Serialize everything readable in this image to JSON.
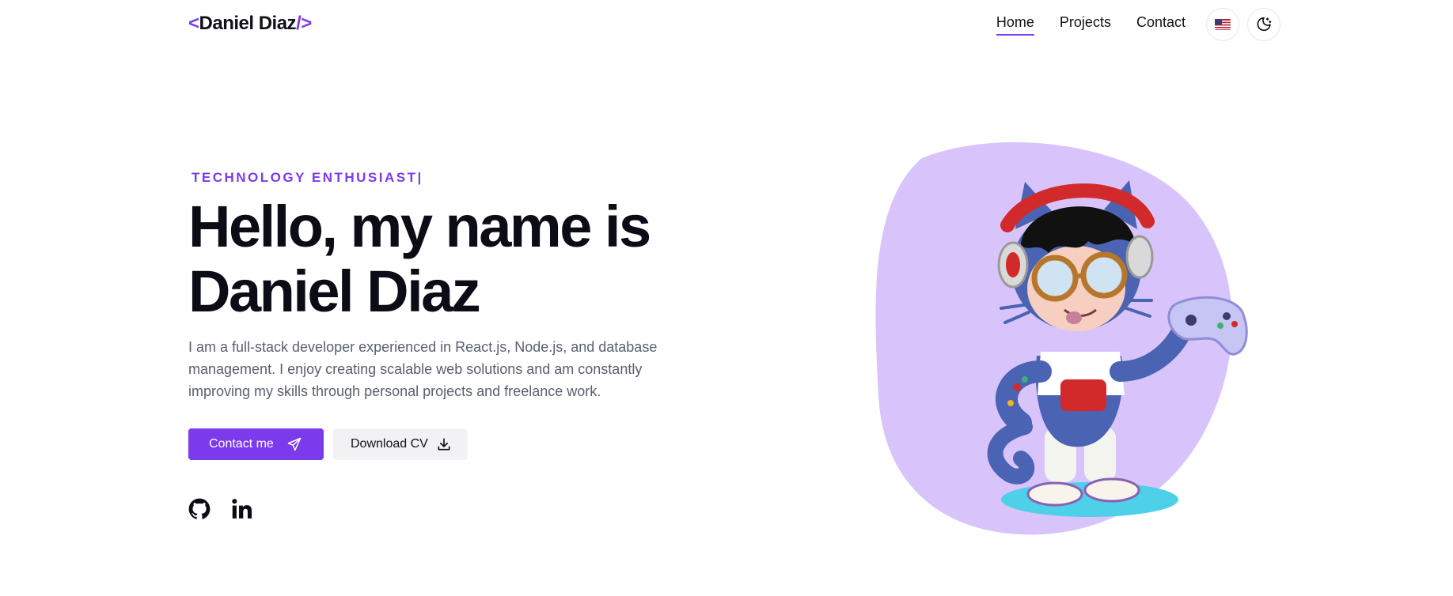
{
  "header": {
    "logo": {
      "open": "<",
      "name": "Daniel Diaz",
      "close": "/>"
    },
    "nav": [
      {
        "label": "Home",
        "active": true
      },
      {
        "label": "Projects",
        "active": false
      },
      {
        "label": "Contact",
        "active": false
      }
    ],
    "language_icon": "us-flag-icon",
    "theme_icon": "moon-stars-icon"
  },
  "hero": {
    "eyebrow": "TECHNOLOGY ENTHUSIAST|",
    "headline_line1": "Hello, my name is",
    "headline_line2": "Daniel Diaz",
    "bio": "I am a full-stack developer experienced in React.js, Node.js, and database management. I enjoy creating scalable web solutions and am constantly improving my skills through personal projects and freelance work.",
    "contact_label": "Contact me",
    "contact_icon": "send-icon",
    "download_label": "Download CV",
    "download_icon": "download-icon",
    "socials": [
      {
        "icon": "github-icon"
      },
      {
        "icon": "linkedin-icon"
      }
    ],
    "illustration": "octocat-gamer-avatar"
  },
  "colors": {
    "accent": "#7c3aed",
    "blob": "#d8c4fb",
    "text": "#0c0c16",
    "muted": "#5a5f6e"
  }
}
